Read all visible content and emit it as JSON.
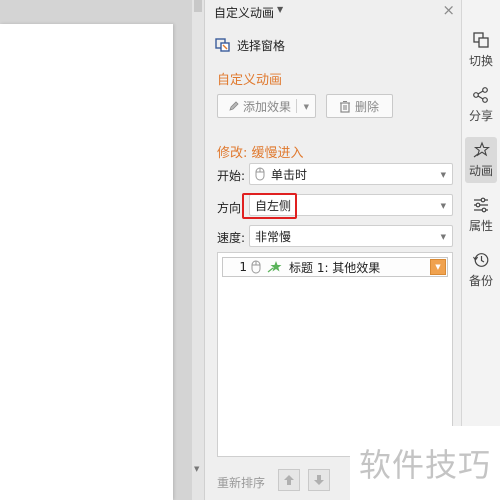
{
  "panel": {
    "title": "自定义动画",
    "close_glyph": "×",
    "selection_pane_label": "选择窗格",
    "section_custom": "自定义动画",
    "add_effect_label": "添加效果",
    "delete_label": "删除",
    "modify_label": "修改: 缓慢进入",
    "start_label": "开始:",
    "start_value": "单击时",
    "direction_label": "方向:",
    "direction_value": "自左侧",
    "speed_label": "速度:",
    "speed_value": "非常慢",
    "list": [
      {
        "num": "1",
        "text": "标题 1: 其他效果"
      }
    ],
    "reorder_label": "重新排序"
  },
  "sidebar": {
    "items": [
      {
        "label": "切换",
        "icon": "transition-icon"
      },
      {
        "label": "分享",
        "icon": "share-icon"
      },
      {
        "label": "动画",
        "icon": "animation-icon",
        "active": true
      },
      {
        "label": "属性",
        "icon": "properties-icon"
      },
      {
        "label": "备份",
        "icon": "backup-icon"
      }
    ]
  },
  "watermark": "软件技巧",
  "colors": {
    "accent_orange": "#e0792e",
    "highlight_red": "#e02020",
    "dropdown_orange": "#f0a24f"
  }
}
